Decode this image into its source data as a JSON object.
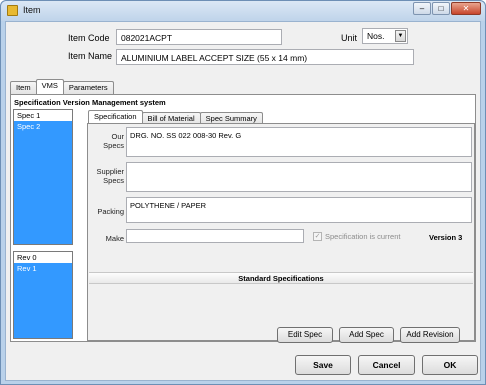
{
  "window": {
    "title": "Item",
    "controls": {
      "minimize": "–",
      "maximize": "□",
      "close": "✕"
    }
  },
  "header": {
    "item_code_label": "Item Code",
    "item_code_value": "082021ACPT",
    "unit_label": "Unit",
    "unit_value": "Nos.",
    "item_name_label": "Item Name",
    "item_name_value": "ALUMINIUM LABEL ACCEPT SIZE (55 x 14 mm)"
  },
  "main_tabs": [
    {
      "label": "Item"
    },
    {
      "label": "VMS"
    },
    {
      "label": "Parameters"
    }
  ],
  "vms": {
    "section_title": "Specification Version Management system",
    "specs": [
      "Spec 1",
      "Spec 2"
    ],
    "revisions": [
      "Rev 0",
      "Rev 1"
    ],
    "inner_tabs": [
      {
        "label": "Specification"
      },
      {
        "label": "Bill of Material"
      },
      {
        "label": "Spec Summary"
      }
    ],
    "our_specs_label_1": "Our",
    "our_specs_label_2": "Specs",
    "our_specs_value": "DRG. NO. SS 022 008-30 Rev. G",
    "supplier_specs_label_1": "Supplier",
    "supplier_specs_label_2": "Specs",
    "supplier_specs_value": "",
    "packing_label": "Packing",
    "packing_value": "POLYTHENE / PAPER",
    "make_label": "Make",
    "make_value": "",
    "current_label": "Specification is current",
    "current_checked": true,
    "version_text": "Version 3",
    "standard_specs_header": "Standard Specifications"
  },
  "actions": {
    "edit_spec": "Edit Spec",
    "add_spec": "Add Spec",
    "add_revision": "Add Revision"
  },
  "dialog_buttons": {
    "save": "Save",
    "cancel": "Cancel",
    "ok": "OK"
  },
  "colors": {
    "selection": "#3399ff",
    "window_frame": "#b9d1ea"
  }
}
